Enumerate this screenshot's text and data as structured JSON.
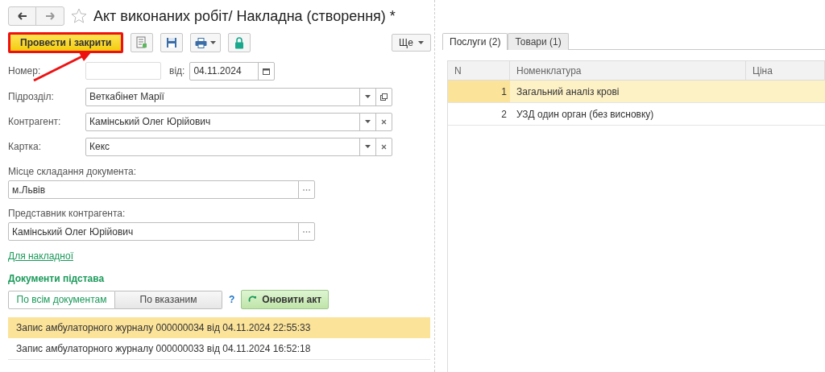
{
  "window": {
    "title": "Акт виконаних робіт/ Накладна (створення) *",
    "favorite": false
  },
  "toolbar": {
    "primary": "Провести і закрити",
    "highlighted": true,
    "more": "Ще"
  },
  "form": {
    "number": {
      "label": "Номер:"
    },
    "date": {
      "label": "від:",
      "value": "04.11.2024"
    },
    "fields": [
      {
        "label": "Підрозділ:",
        "value": "Веткабінет Марії",
        "kind": "open"
      },
      {
        "label": "Контрагент:",
        "value": "Камінський Олег Юрійович",
        "kind": "clear"
      },
      {
        "label": "Картка:",
        "value": "Кекс",
        "kind": "clear"
      }
    ],
    "place": {
      "label": "Місце складання документа:",
      "value": "м.Львів"
    },
    "representative": {
      "label": "Представник контрагента:",
      "value": "Камінський Олег Юрійович"
    },
    "link": "Для накладної"
  },
  "basis": {
    "title": "Документи підстава",
    "toggle": [
      {
        "label": "По всім документам",
        "selected": true
      },
      {
        "label": "По вказаним",
        "selected": false
      }
    ],
    "help": "?",
    "refresh": "Оновити акт",
    "rows": [
      {
        "text": "Запис амбулаторного журналу 000000034 від 04.11.2024 22:55:33",
        "selected": true
      },
      {
        "text": "Запис амбулаторного журналу 000000033 від 04.11.2024 16:52:18",
        "selected": false
      }
    ]
  },
  "tabs": [
    {
      "label": "Послуги (2)",
      "selected": true
    },
    {
      "label": "Товари (1)",
      "selected": false
    }
  ],
  "table": {
    "columns": [
      "N",
      "Номенклатура",
      "Ціна"
    ],
    "rows": [
      {
        "n": "1",
        "name": "Загальний аналіз крові",
        "selected": true
      },
      {
        "n": "2",
        "name": "УЗД один орган (без висновку)",
        "selected": false
      }
    ]
  }
}
